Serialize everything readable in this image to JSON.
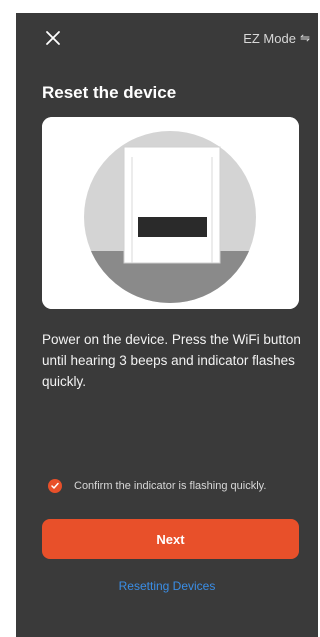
{
  "header": {
    "close_icon": "close-icon",
    "mode_label": "EZ Mode",
    "mode_icon": "⇋"
  },
  "page": {
    "title": "Reset the device",
    "instructions": "Power on the device. Press the WiFi button until hearing 3 beeps and indicator flashes quickly."
  },
  "illustration": {
    "icon": "device-illustration"
  },
  "confirm": {
    "label": "Confirm the indicator is flashing quickly.",
    "checked": true
  },
  "actions": {
    "next_label": "Next",
    "reset_link_label": "Resetting Devices"
  },
  "colors": {
    "background": "#3a3a3a",
    "accent": "#e8502a",
    "link": "#3a8ee6"
  }
}
